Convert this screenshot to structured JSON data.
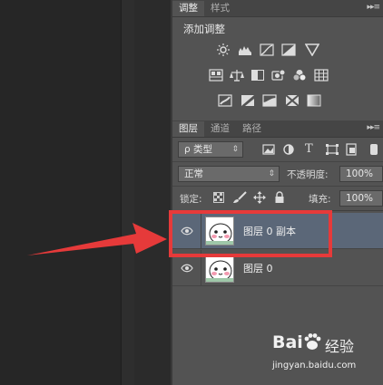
{
  "adjust_panel": {
    "tabs": [
      {
        "label": "调整"
      },
      {
        "label": "样式"
      }
    ],
    "title": "添加调整",
    "menu_glyph": "▸▸≡"
  },
  "layers_panel": {
    "tabs": [
      {
        "label": "图层"
      },
      {
        "label": "通道"
      },
      {
        "label": "路径"
      }
    ],
    "filter": {
      "label": "ρ 类型",
      "arrow": "⇕"
    },
    "filter_icon_text": "T",
    "blend_mode": {
      "value": "正常",
      "arrow": "⇕"
    },
    "opacity_label": "不透明度:",
    "opacity_value": "100%",
    "lock_label": "锁定:",
    "fill_label": "填充:",
    "fill_value": "100%",
    "layers": [
      {
        "name": "图层 0 副本",
        "selected": true
      },
      {
        "name": "图层 0",
        "selected": false
      }
    ]
  },
  "watermark": {
    "brand": "Bai",
    "brand_suffix": "经验",
    "url": "jingyan.baidu.com"
  },
  "colors": {
    "annotation_red": "#e63a3a",
    "panel_bg": "#535353",
    "selected_layer_bg": "#5b6778"
  }
}
